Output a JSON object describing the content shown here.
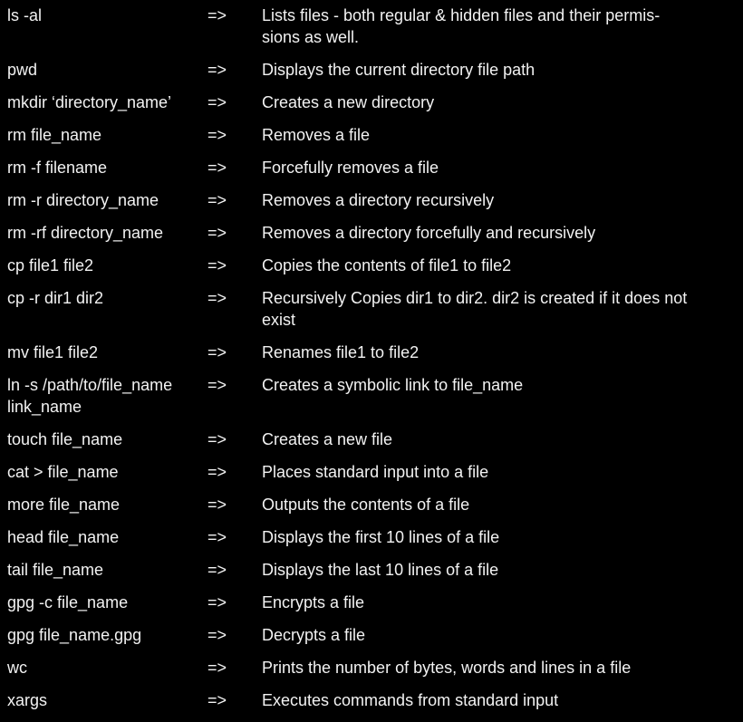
{
  "arrow": "=>",
  "rows": [
    {
      "command": "ls -al",
      "description": "Lists files - both regular &  hidden files and their permis-\nsions as well."
    },
    {
      "command": "pwd",
      "description": "Displays the current directory file path"
    },
    {
      "command": "mkdir ‘directory_name’",
      "description": "Creates a new directory"
    },
    {
      "command": "rm file_name",
      "description": "Removes a file"
    },
    {
      "command": "rm -f filename",
      "description": "Forcefully removes a file"
    },
    {
      "command": "rm -r directory_name",
      "description": "Removes a directory recursively"
    },
    {
      "command": "rm -rf directory_name",
      "description": "Removes a directory forcefully and recursively"
    },
    {
      "command": "cp file1 file2",
      "description": "Copies the contents of file1 to file2"
    },
    {
      "command": "cp -r dir1 dir2",
      "description": "Recursively Copies dir1 to dir2. dir2 is created if it does not\nexist"
    },
    {
      "command": "mv file1 file2",
      "description": "Renames file1 to file2"
    },
    {
      "command": "ln -s /path/to/file_name\nlink_name",
      "description": "Creates a symbolic link to file_name"
    },
    {
      "command": "touch file_name",
      "description": "Creates a new file"
    },
    {
      "command": "cat > file_name",
      "description": "Places standard input into a file"
    },
    {
      "command": "more file_name",
      "description": "Outputs the contents of a file"
    },
    {
      "command": "head file_name",
      "description": "Displays the first 10 lines of a file"
    },
    {
      "command": "tail file_name",
      "description": "Displays the last 10 lines of a file"
    },
    {
      "command": "gpg -c file_name",
      "description": "Encrypts a file"
    },
    {
      "command": "gpg file_name.gpg",
      "description": "Decrypts a file"
    },
    {
      "command": "wc",
      "description": "Prints the number of bytes, words and lines in a file"
    },
    {
      "command": "xargs",
      "description": "Executes commands from standard input"
    }
  ]
}
